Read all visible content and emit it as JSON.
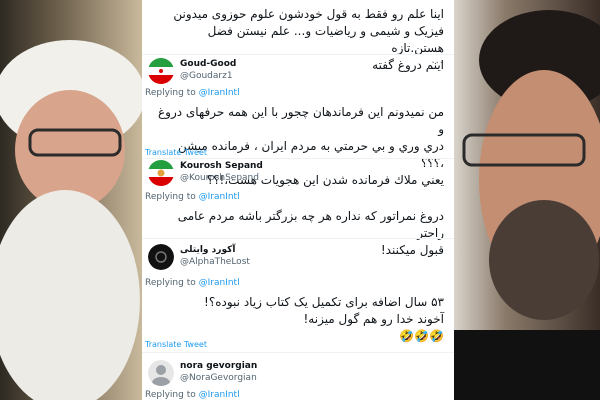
{
  "colors": {
    "link": "#1d9bf0",
    "text": "#0f1419",
    "muted": "#536471"
  },
  "tweets": [
    {
      "text_lines": [
        "اینا علم رو فقط به قول خودشون علوم حوزوی میدونن",
        "فیزیک و شیمی و ریاضیات و... علم نیستن فضل هستن.تازه",
        "اینم دروغ گفته"
      ]
    },
    {
      "display_name": "Goud-Good",
      "handle": "@Goudarz1",
      "avatar_icon": "iran-flag-avatar",
      "reply_prefix": "Replying to",
      "reply_to": "@IranIntl",
      "text_lines": [
        "من نمیدونم این فرماندهان چجور با این همه حرفهای دروغ و",
        "دري وري و بي حرمتي به مردم ایران ، فرمانده میشن ،؟؟؟",
        "یعني ملاك فرمانده شدن این هجویات هست،!؟؟"
      ],
      "translate": "Translate Tweet"
    },
    {
      "display_name": "Kourosh Sepand",
      "handle": "@KouroshSepand",
      "avatar_icon": "flag-avatar",
      "reply_prefix": "Replying to",
      "reply_to": "@IranIntl",
      "text_lines": [
        "دروغ نمراتور که نداره هر چه بزرگتر باشه مردم عامی راحتر",
        "قبول میکنند!"
      ]
    },
    {
      "display_name": "آکورد وایتلی",
      "handle": "@AlphaTheLost",
      "avatar_icon": "dark-avatar",
      "reply_prefix": "Replying to",
      "reply_to": "@IranIntl",
      "text_lines": [
        "۵۳ سال اضافه برای تکمیل یک کتاب زیاد نبوده؟!",
        "آخوند خدا رو هم گول میزنه!",
        "🤣🤣🤣"
      ],
      "translate": "Translate Tweet"
    },
    {
      "display_name": "nora gevorgian",
      "handle": "@NoraGevorgian",
      "avatar_icon": "default-avatar",
      "reply_prefix": "Replying to",
      "reply_to": "@IranIntl"
    }
  ]
}
